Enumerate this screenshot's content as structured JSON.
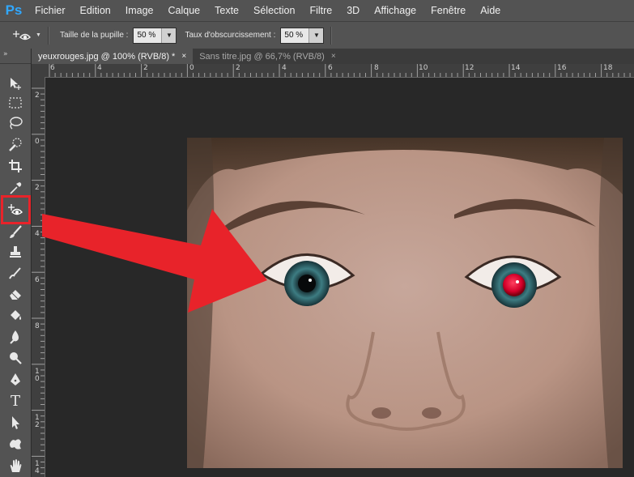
{
  "app": {
    "logo": "Ps"
  },
  "menu": [
    "Fichier",
    "Edition",
    "Image",
    "Calque",
    "Texte",
    "Sélection",
    "Filtre",
    "3D",
    "Affichage",
    "Fenêtre",
    "Aide"
  ],
  "options": {
    "tool_icon": "red-eye-tool-icon",
    "pupil_label": "Taille de la pupille :",
    "pupil_value": "50 %",
    "darken_label": "Taux d'obscurcissement :",
    "darken_value": "50 %"
  },
  "tabs": [
    {
      "label": "yeuxrouges.jpg @ 100% (RVB/8) *",
      "close": "×",
      "active": true
    },
    {
      "label": "Sans titre.jpg @ 66,7% (RVB/8)",
      "close": "×",
      "active": false
    }
  ],
  "ruler": {
    "h_labels": [
      "6",
      "4",
      "2",
      "0",
      "2",
      "4",
      "6",
      "8",
      "10",
      "12",
      "14",
      "16",
      "18"
    ],
    "v_labels": [
      "2",
      "0",
      "2",
      "4",
      "6",
      "8",
      "1",
      "0",
      "1",
      "2",
      "1",
      "4"
    ]
  },
  "toolbar": {
    "header": "»",
    "tools": [
      "move-tool-icon",
      "marquee-tool-icon",
      "lasso-tool-icon",
      "quick-selection-tool-icon",
      "crop-tool-icon",
      "eyedropper-tool-icon",
      "red-eye-tool-icon",
      "brush-tool-icon",
      "clone-stamp-tool-icon",
      "history-brush-tool-icon",
      "eraser-tool-icon",
      "paint-bucket-tool-icon",
      "blur-tool-icon",
      "dodge-tool-icon",
      "pen-tool-icon",
      "type-tool-icon",
      "path-selection-tool-icon",
      "custom-shape-tool-icon",
      "hand-tool-icon"
    ],
    "type_glyph": "T"
  },
  "annotation": {
    "color": "#e8232a"
  },
  "colors": {
    "accent": "#31a8ff",
    "panel": "#535353",
    "workspace": "#282828"
  }
}
